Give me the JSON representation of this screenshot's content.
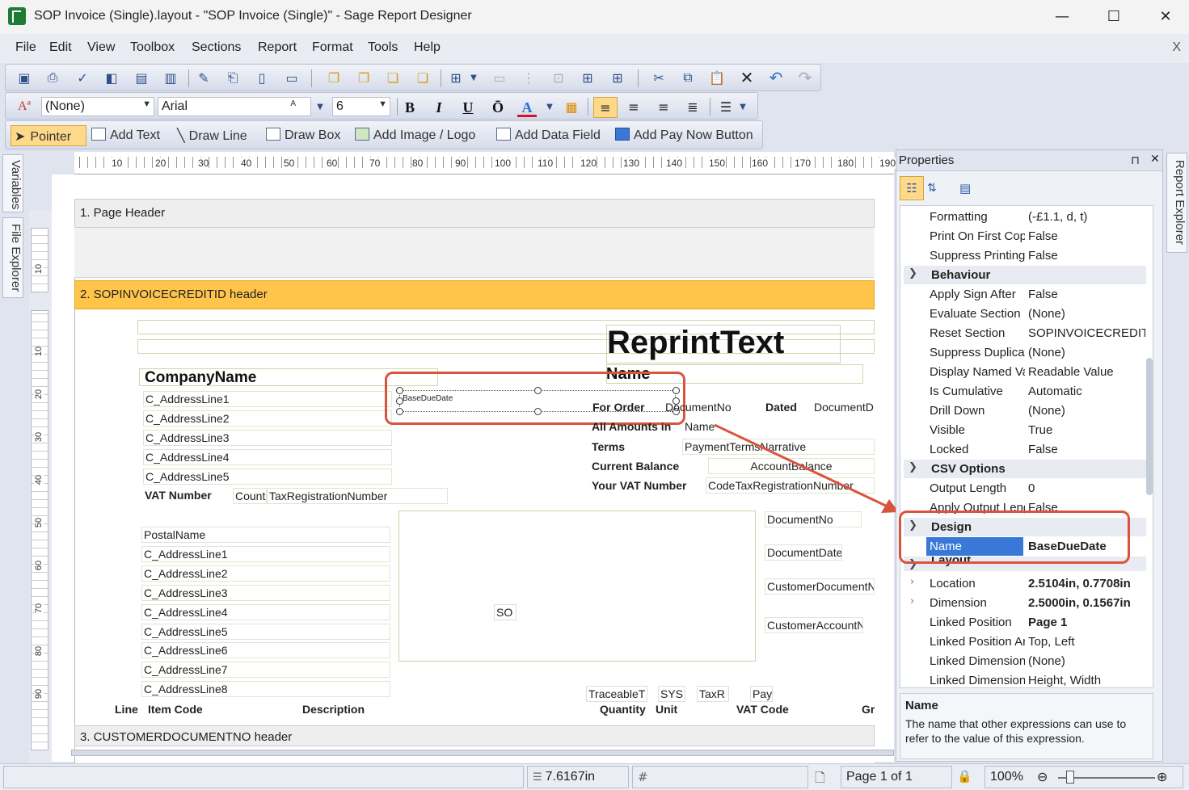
{
  "window": {
    "title": "SOP Invoice (Single).layout - \"SOP Invoice (Single)\" - Sage Report Designer",
    "minimize": "—",
    "maximize": "☐",
    "close": "✕"
  },
  "menu": {
    "items": [
      "File",
      "Edit",
      "View",
      "Toolbox",
      "Sections",
      "Report",
      "Format",
      "Tools",
      "Help"
    ],
    "mdi_close": "X"
  },
  "format_toolbar": {
    "style_value": "(None)",
    "font_value": "Arial",
    "size_value": "6",
    "bold": "B",
    "italic": "I",
    "underline": "U",
    "overline": "Ō",
    "font_color": "A"
  },
  "tools_toolbar": {
    "pointer": "Pointer",
    "add_text": "Add Text",
    "draw_line": "Draw Line",
    "draw_box": "Draw Box",
    "add_image": "Add Image / Logo",
    "add_data_field": "Add Data Field",
    "add_pay_now": "Add Pay Now Button"
  },
  "left_tabs": [
    "Variables",
    "File Explorer"
  ],
  "right_tabs": [
    "Report Explorer"
  ],
  "ruler": {
    "h_labels": [
      "10",
      "20",
      "30",
      "40",
      "50",
      "60",
      "70",
      "80",
      "90",
      "100",
      "110",
      "120",
      "130",
      "140",
      "150",
      "160",
      "170",
      "180",
      "190"
    ],
    "v_labels_a": [
      "10"
    ],
    "v_labels_b": [
      "10",
      "20",
      "30",
      "40",
      "50",
      "60",
      "70",
      "80",
      "90"
    ]
  },
  "sections": {
    "page_header": "1. Page Header",
    "invoice_header": "2. SOPINVOICECREDITID header",
    "customer_header": "3. CUSTOMERDOCUMENTNO header"
  },
  "report": {
    "reprint": "ReprintText",
    "name_big": "Name",
    "company": "CompanyName",
    "address": [
      "C_AddressLine1",
      "C_AddressLine2",
      "C_AddressLine3",
      "C_AddressLine4",
      "C_AddressLine5"
    ],
    "vat_label": "VAT Number",
    "vat_count": "Count",
    "vat_reg": "TaxRegistrationNumber",
    "base_due_date": "BaseDueDate",
    "for_order": "For Order",
    "document_no": "DocumentNo",
    "dated": "Dated",
    "document_d": "DocumentD",
    "all_amounts": "All Amounts in",
    "name_field": "Name",
    "terms": "Terms",
    "payment_terms": "PaymentTermsNarrative",
    "current_balance": "Current Balance",
    "account_balance": "AccountBalance",
    "your_vat": "Your VAT Number",
    "code_tax": "CodeTaxRegistrationNumber",
    "postal_name": "PostalName",
    "postal_address": [
      "C_AddressLine1",
      "C_AddressLine2",
      "C_AddressLine3",
      "C_AddressLine4",
      "C_AddressLine5",
      "C_AddressLine6",
      "C_AddressLine7",
      "C_AddressLine8"
    ],
    "so": "SO",
    "right_fields": [
      "DocumentNo",
      "DocumentDate",
      "CustomerDocumentNo",
      "CustomerAccountNumber"
    ],
    "traceable": "TraceableT",
    "sys": "SYS",
    "taxr": "TaxR",
    "pay": "Pay",
    "col_line": "Line",
    "col_item_code": "Item Code",
    "col_description": "Description",
    "col_quantity": "Quantity",
    "col_unit": "Unit",
    "col_vat_code": "VAT Code",
    "col_gr": "Gr"
  },
  "properties": {
    "title": "Properties",
    "pin": "⊓",
    "close": "✕",
    "rows_top": [
      {
        "name": "Formatting",
        "value": "(-£1.1, d, t)"
      },
      {
        "name": "Print On First Copy",
        "value": "False"
      },
      {
        "name": "Suppress Printing",
        "value": "False"
      }
    ],
    "behaviour": "Behaviour",
    "rows_behaviour": [
      {
        "name": "Apply Sign After",
        "value": "False"
      },
      {
        "name": "Evaluate Section",
        "value": "(None)"
      },
      {
        "name": "Reset Section",
        "value": "SOPINVOICECREDITID"
      },
      {
        "name": "Suppress Duplicates",
        "value": "(None)"
      },
      {
        "name": "Display Named Value",
        "value": "Readable Value"
      },
      {
        "name": "Is Cumulative",
        "value": "Automatic"
      },
      {
        "name": "Drill Down",
        "value": "(None)"
      },
      {
        "name": "Visible",
        "value": "True"
      },
      {
        "name": "Locked",
        "value": "False"
      }
    ],
    "csv": "CSV Options",
    "rows_csv": [
      {
        "name": "Output Length",
        "value": "0"
      },
      {
        "name": "Apply Output Length",
        "value": "False"
      }
    ],
    "design": "Design",
    "design_name_label": "Name",
    "design_name_value": "BaseDueDate",
    "layout": "Layout",
    "rows_layout": [
      {
        "name": "Location",
        "value": "2.5104in, 0.7708in",
        "bold": true,
        "expand": true
      },
      {
        "name": "Dimension",
        "value": "2.5000in, 0.1567in",
        "bold": true,
        "expand": true
      },
      {
        "name": "Linked Position",
        "value": "Page 1",
        "bold": true,
        "expand": false
      },
      {
        "name": "Linked Position Anchor",
        "value": "Top, Left",
        "bold": false,
        "expand": false
      },
      {
        "name": "Linked Dimension",
        "value": "(None)",
        "bold": false,
        "expand": false
      },
      {
        "name": "Linked Dimension Mode",
        "value": "Height, Width",
        "bold": false,
        "expand": false
      }
    ],
    "help_title": "Name",
    "help_text": "The name that other expressions can use to refer to the value of this expression."
  },
  "status": {
    "position": "7.6167in",
    "page": "Page 1 of 1",
    "zoom": "100%"
  },
  "colors": {
    "accent": "#ffc44a",
    "highlight_red": "#d9543e",
    "selection_blue": "#3a78d8"
  }
}
